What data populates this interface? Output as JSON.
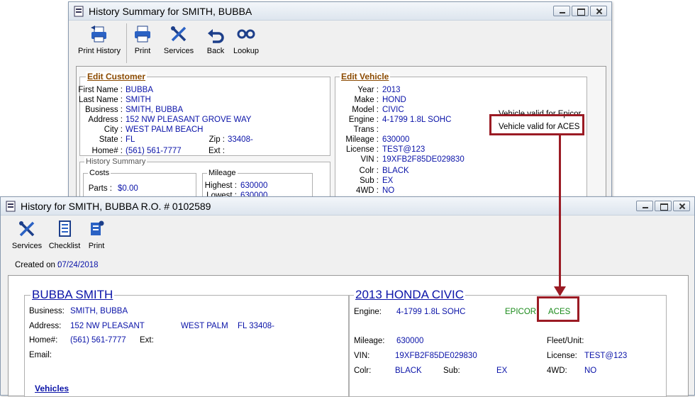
{
  "back_window": {
    "title": "History Summary for SMITH, BUBBA",
    "toolbar": [
      {
        "label": "Print History",
        "icon": "print-history-icon"
      },
      {
        "label": "Print",
        "icon": "printer-icon"
      },
      {
        "label": "Services",
        "icon": "tools-icon"
      },
      {
        "label": "Back",
        "icon": "back-arrow-icon"
      },
      {
        "label": "Lookup",
        "icon": "binoculars-icon"
      }
    ],
    "customer": {
      "legend": "Edit Customer",
      "first_name_label": "First Name :",
      "first_name": "BUBBA",
      "last_name_label": "Last Name :",
      "last_name": "SMITH",
      "business_label": "Business :",
      "business": "SMITH, BUBBA",
      "address_label": "Address :",
      "address": "152 NW PLEASANT GROVE WAY",
      "city_label": "City :",
      "city": "WEST PALM BEACH",
      "state_label": "State :",
      "state": "FL",
      "zip_label": "Zip :",
      "zip": "33408-",
      "home_label": "Home# :",
      "home": "(561) 561-7777",
      "ext_label": "Ext :"
    },
    "history": {
      "legend": "History Summary",
      "costs_legend": "Costs",
      "parts_label": "Parts :",
      "parts": "$0.00",
      "mileage_legend": "Mileage",
      "highest_label": "Highest :",
      "highest": "630000",
      "lowest_label": "Lowest :",
      "lowest": "630000"
    },
    "vehicle": {
      "legend": "Edit Vehicle",
      "year_label": "Year :",
      "year": "2013",
      "make_label": "Make :",
      "make": "HOND",
      "model_label": "Model :",
      "model": "CIVIC",
      "engine_label": "Engine :",
      "engine": "4-1799 1.8L SOHC",
      "trans_label": "Trans :",
      "mileage_label": "Mileage :",
      "mileage": "630000",
      "license_label": "License :",
      "license": "TEST@123",
      "vin_label": "VIN :",
      "vin": "19XFB2F85DE029830",
      "colr_label": "Colr :",
      "colr": "BLACK",
      "sub_label": "Sub :",
      "sub": "EX",
      "4wd_label": "4WD :",
      "4wd": "NO",
      "valid_epicor": "Vehicle valid for Epicor",
      "valid_aces": "Vehicle valid for ACES"
    }
  },
  "front_window": {
    "title": "History for SMITH, BUBBA R.O. # 0102589",
    "toolbar": [
      {
        "label": "Services",
        "icon": "tools-icon"
      },
      {
        "label": "Checklist",
        "icon": "checklist-icon"
      },
      {
        "label": "Print",
        "icon": "print-settings-icon"
      }
    ],
    "created_label": "Created on :",
    "created": "07/24/2018",
    "customer": {
      "name": "BUBBA SMITH",
      "business_label": "Business:",
      "business": "SMITH, BUBBA",
      "address_label": "Address:",
      "address": "152 NW PLEASANT",
      "city": "WEST PALM",
      "state_zip": "FL  33408-",
      "home_label": "Home#:",
      "home": "(561) 561-7777",
      "ext_label": "Ext:",
      "email_label": "Email:",
      "vehicles_link": "Vehicles"
    },
    "vehicle": {
      "title": "2013 HONDA CIVIC",
      "engine_label": "Engine:",
      "engine": "4-1799 1.8L SOHC",
      "epicor": "EPICOR",
      "aces": "ACES",
      "mileage_label": "Mileage:",
      "mileage": "630000",
      "fleet_label": "Fleet/Unit:",
      "vin_label": "VIN:",
      "vin": "19XFB2F85DE029830",
      "license_label": "License:",
      "license": "TEST@123",
      "colr_label": "Colr:",
      "colr": "BLACK",
      "sub_label": "Sub:",
      "sub": "EX",
      "4wd_label": "4WD:",
      "4wd": "NO"
    }
  },
  "colors": {
    "highlight": "#9b1b24",
    "value_blue": "#0a13a8",
    "valid_green": "#1a8a1a",
    "edit_link": "#8b4a00"
  }
}
